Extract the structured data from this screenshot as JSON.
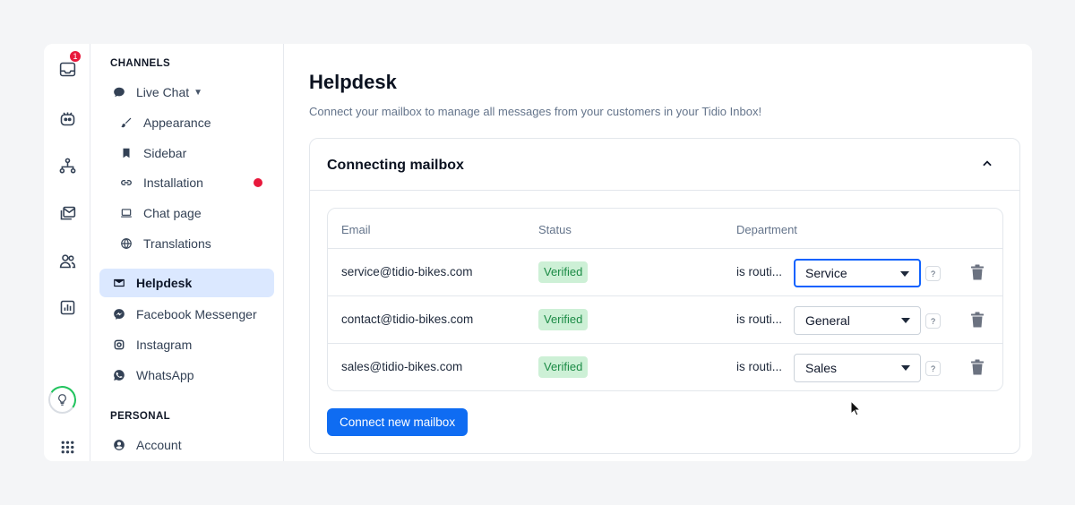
{
  "rail": {
    "inbox_badge": "1",
    "icons": [
      "inbox-icon",
      "bot-icon",
      "flows-icon",
      "mail-stack-icon",
      "contacts-icon",
      "analytics-icon",
      "lightbulb-icon",
      "apps-grid-icon"
    ]
  },
  "sidebar": {
    "channels_heading": "CHANNELS",
    "live_chat": "Live Chat",
    "items": [
      {
        "label": "Appearance",
        "icon": "brush-icon"
      },
      {
        "label": "Sidebar",
        "icon": "bookmark-icon"
      },
      {
        "label": "Installation",
        "icon": "link-icon"
      },
      {
        "label": "Chat page",
        "icon": "laptop-icon"
      },
      {
        "label": "Translations",
        "icon": "globe-icon"
      }
    ],
    "helpdesk": "Helpdesk",
    "facebook": "Facebook Messenger",
    "instagram": "Instagram",
    "whatsapp": "WhatsApp",
    "personal_heading": "PERSONAL",
    "account": "Account"
  },
  "main": {
    "title": "Helpdesk",
    "subtitle": "Connect your mailbox to manage all messages from your customers in your Tidio Inbox!",
    "card_title": "Connecting mailbox",
    "columns": {
      "email": "Email",
      "status": "Status",
      "department": "Department"
    },
    "rows": [
      {
        "email": "service@tidio-bikes.com",
        "status": "Verified",
        "routing": "is routi...",
        "department": "Service",
        "help": "?"
      },
      {
        "email": "contact@tidio-bikes.com",
        "status": "Verified",
        "routing": "is routi...",
        "department": "General",
        "help": "?"
      },
      {
        "email": "sales@tidio-bikes.com",
        "status": "Verified",
        "routing": "is routi...",
        "department": "Sales",
        "help": "?"
      }
    ],
    "connect_button": "Connect new mailbox"
  },
  "colors": {
    "accent": "#0f6cf2",
    "active_nav": "#dbe8ff",
    "verified_bg": "#cdf0d6",
    "verified_text": "#1c8b46",
    "alert": "#e8193c"
  }
}
